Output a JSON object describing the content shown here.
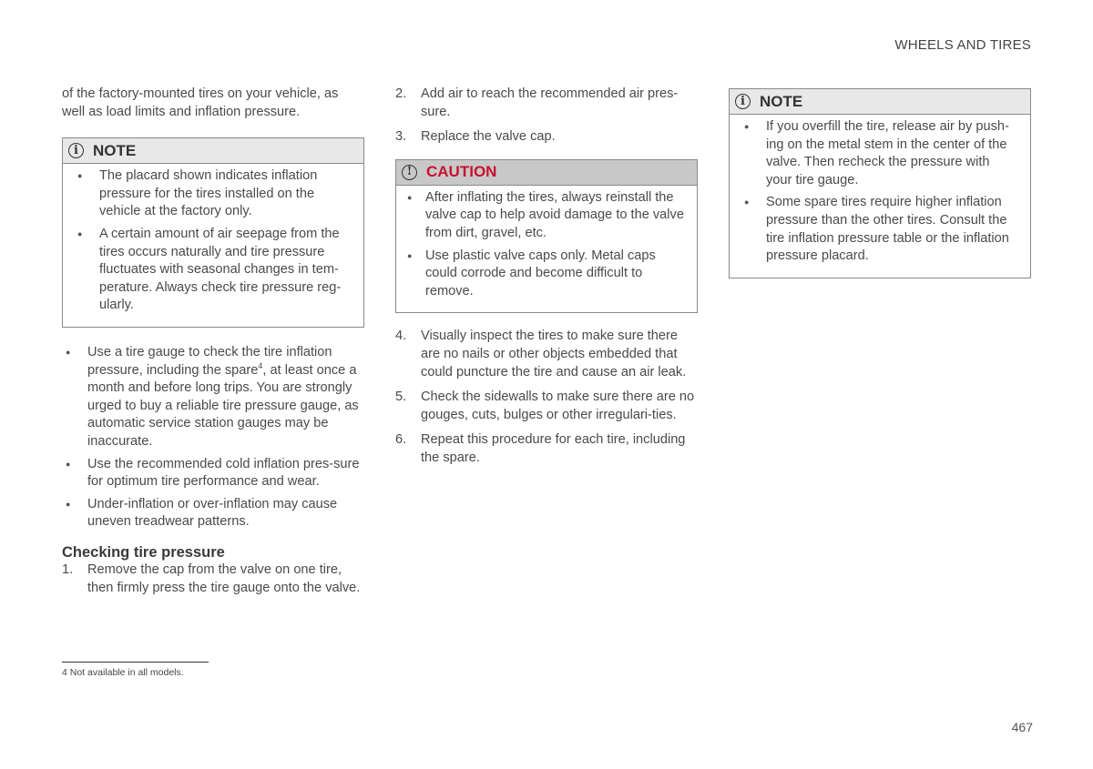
{
  "header": {
    "section_title": "WHEELS AND TIRES"
  },
  "column1": {
    "intro": "of the factory-mounted tires on your vehicle, as well as load limits and inflation pressure.",
    "note": {
      "icon": "info-icon",
      "icon_glyph": "i",
      "title": "NOTE",
      "items": [
        "The placard shown indicates inflation pressure for the tires installed on the vehicle at the factory only.",
        "A certain amount of air seepage from the tires occurs naturally and tire pressure fluctuates with seasonal changes in tem-perature. Always check tire pressure reg-ularly."
      ]
    },
    "bullets": [
      {
        "before": "Use a tire gauge to check the tire inflation pressure, including the spare",
        "sup": "4",
        "after": ", at least once a month and before long trips. You are strongly urged to buy a reliable tire pressure gauge, as automatic service station gauges may be inaccurate."
      },
      {
        "text": "Use the recommended cold inflation pres-sure for optimum tire performance and wear."
      },
      {
        "text": "Under-inflation or over-inflation may cause uneven treadwear patterns."
      }
    ],
    "section_heading": "Checking tire pressure",
    "steps": [
      {
        "num": "1.",
        "text": "Remove the cap from the valve on one tire, then firmly press the tire gauge onto the valve."
      }
    ]
  },
  "column2": {
    "steps_a": [
      {
        "num": "2.",
        "text": "Add air to reach the recommended air pres-sure."
      },
      {
        "num": "3.",
        "text": "Replace the valve cap."
      }
    ],
    "caution": {
      "icon": "exclamation-icon",
      "icon_glyph": "!",
      "title": "CAUTION",
      "color": "#c8102e",
      "items": [
        "After inflating the tires, always reinstall the valve cap to help avoid damage to the valve from dirt, gravel, etc.",
        "Use plastic valve caps only. Metal caps could corrode and become difficult to remove."
      ]
    },
    "steps_b": [
      {
        "num": "4.",
        "text": "Visually inspect the tires to make sure there are no nails or other objects embedded that could puncture the tire and cause an air leak."
      },
      {
        "num": "5.",
        "text": "Check the sidewalls to make sure there are no gouges, cuts, bulges or other irregulari-ties."
      },
      {
        "num": "6.",
        "text": "Repeat this procedure for each tire, including the spare."
      }
    ]
  },
  "column3": {
    "note": {
      "icon": "info-icon",
      "icon_glyph": "i",
      "title": "NOTE",
      "items": [
        "If you overfill the tire, release air by push-ing on the metal stem in the center of the valve. Then recheck the pressure with your tire gauge.",
        "Some spare tires require higher inflation pressure than the other tires. Consult the tire inflation pressure table or the inflation pressure placard."
      ]
    }
  },
  "footnote": {
    "marker": "4",
    "text": " Not available in all models."
  },
  "page_number": "467"
}
